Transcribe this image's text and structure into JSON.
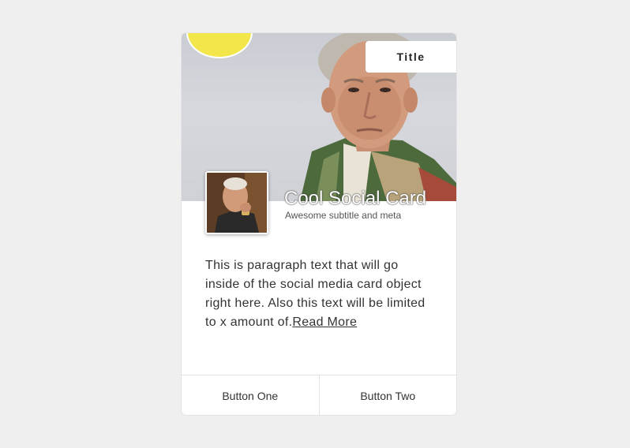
{
  "card": {
    "title_tab": "Title",
    "title": "Cool Social Card",
    "subtitle": "Awesome subtitle and meta",
    "paragraph": "This is paragraph text that will go inside of the social media card object right here. Also this text will be limited to x amount of.",
    "read_more": "Read More",
    "buttons": [
      "Button One",
      "Button Two"
    ]
  },
  "colors": {
    "badge": "#f2e64a",
    "background": "#efefef"
  }
}
